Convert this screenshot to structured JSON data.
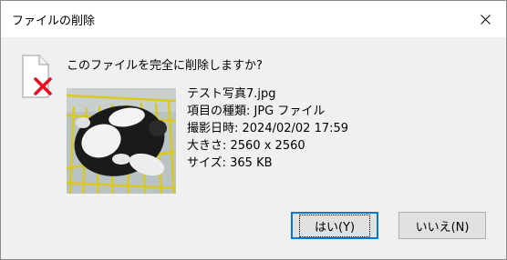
{
  "window": {
    "title": "ファイルの削除",
    "close_icon": "close-icon"
  },
  "dialog": {
    "question": "このファイルを完全に削除しますか?",
    "file_icon": "file-delete-icon",
    "file": {
      "name": "テスト写真7.jpg",
      "type": "項目の種類: JPG ファイル",
      "date": "撮影日時: 2024/02/02 17:59",
      "dimensions": "大きさ: 2560 x 2560",
      "size": "サイズ: 365 KB"
    }
  },
  "buttons": {
    "yes_label": "はい(Y)",
    "no_label": "いいえ(N)"
  },
  "colors": {
    "accent": "#0078d7",
    "delete_x": "#e81123",
    "dialog_bg": "#f0f0f0"
  }
}
